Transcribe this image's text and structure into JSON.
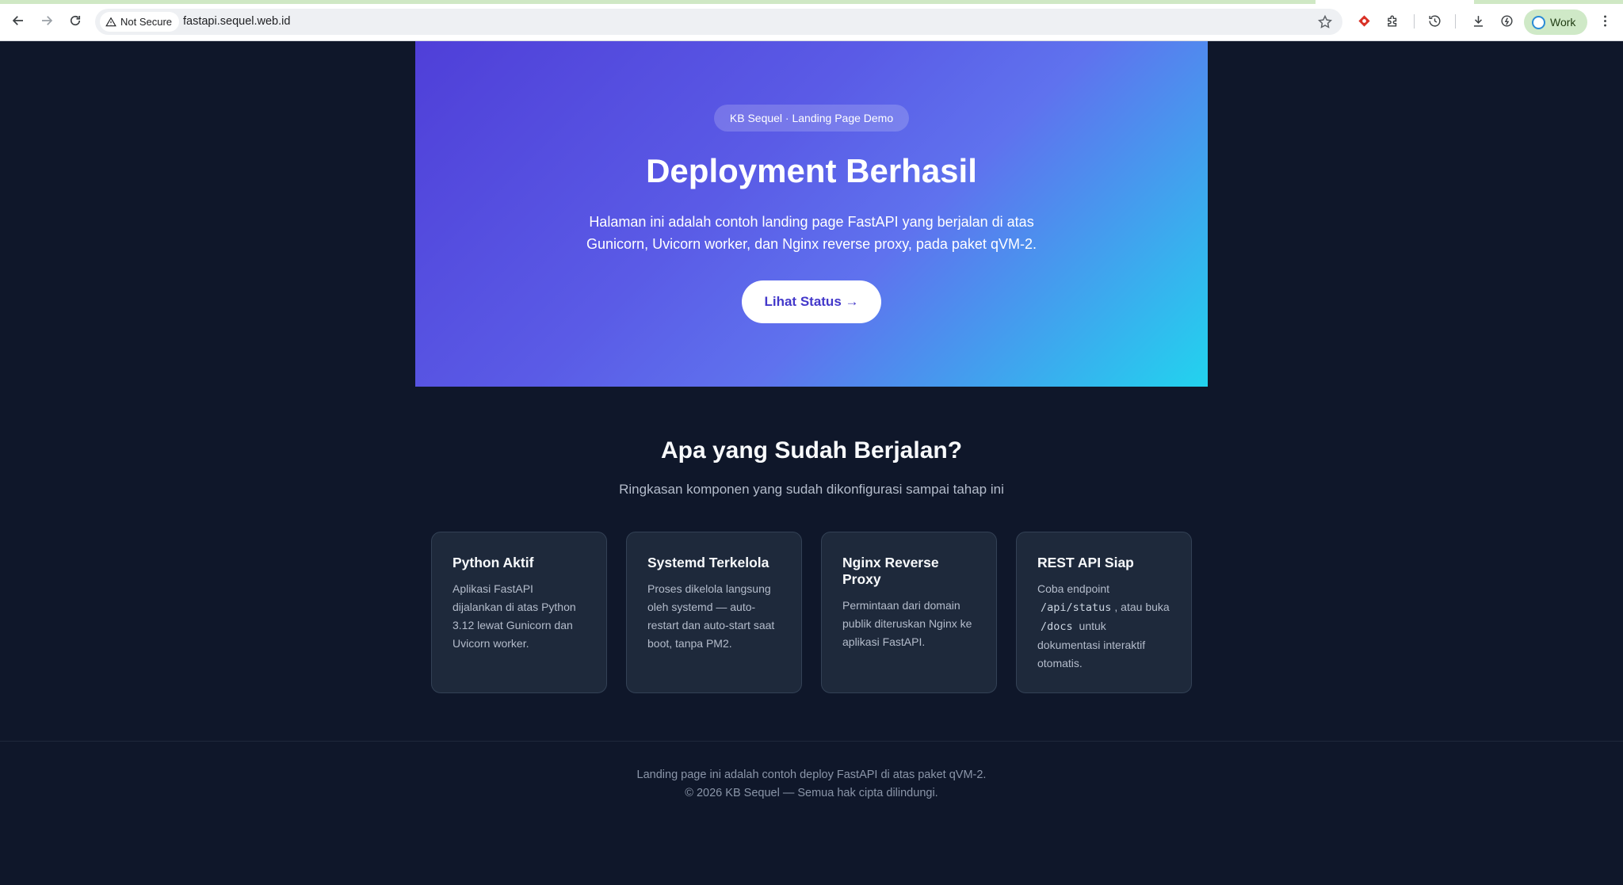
{
  "browser": {
    "security_label": "Not Secure",
    "url": "fastapi.sequel.web.id",
    "profile_label": "Work"
  },
  "hero": {
    "badge": "KB Sequel · Landing Page Demo",
    "title": "Deployment Berhasil",
    "description": "Halaman ini adalah contoh landing page FastAPI yang berjalan di atas Gunicorn, Uvicorn worker, dan Nginx reverse proxy, pada paket qVM-2.",
    "button_label": "Lihat Status →"
  },
  "features": {
    "title": "Apa yang Sudah Berjalan?",
    "subtitle": "Ringkasan komponen yang sudah dikonfigurasi sampai tahap ini",
    "cards": [
      {
        "title": "Python Aktif",
        "body": "Aplikasi FastAPI dijalankan di atas Python 3.12 lewat Gunicorn dan Uvicorn worker."
      },
      {
        "title": "Systemd Terkelola",
        "body": "Proses dikelola langsung oleh systemd — auto-restart dan auto-start saat boot, tanpa PM2."
      },
      {
        "title": "Nginx Reverse Proxy",
        "body": "Permintaan dari domain publik diteruskan Nginx ke aplikasi FastAPI."
      },
      {
        "title": "REST API Siap",
        "body_pre": "Coba endpoint",
        "code1": "/api/status",
        "body_mid": ", atau buka",
        "code2": "/docs",
        "body_post": "untuk dokumentasi interaktif otomatis."
      }
    ]
  },
  "footer": {
    "line1": "Landing page ini adalah contoh deploy FastAPI di atas paket qVM-2.",
    "line2": "© 2026 KB Sequel — Semua hak cipta dilindungi."
  },
  "colors": {
    "page_bg": "#0f172a",
    "card_bg": "#1e293b",
    "hero_gradient_start": "#4f3fd8",
    "hero_gradient_end": "#22d3ee",
    "button_text": "#4338ca"
  }
}
